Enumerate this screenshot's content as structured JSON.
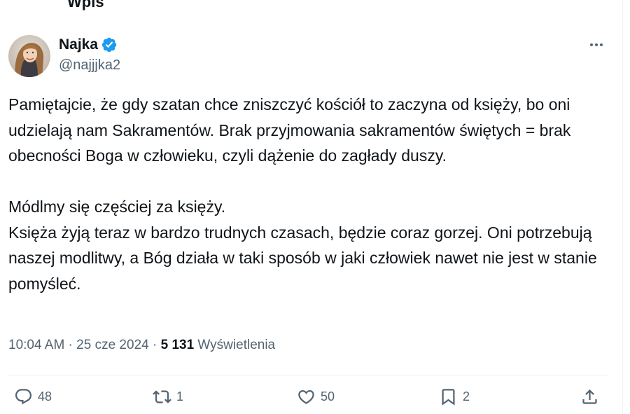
{
  "header": {
    "title_partial": "Wpis"
  },
  "author": {
    "display_name": "Najka",
    "handle": "@najjjka2",
    "verified_icon": "verified-badge-icon"
  },
  "tweet": {
    "paragraph1": "Pamiętajcie, że gdy szatan chce zniszczyć kościół to zaczyna od księży, bo oni udzielają nam Sakramentów. Brak przyjmowania sakramentów świętych = brak obecności Boga w człowieku, czyli dążenie do zagłady duszy.",
    "paragraph2_line1": "Módlmy się częściej za księży.",
    "paragraph2_rest": "Księża żyją teraz w bardzo trudnych czasach, będzie coraz gorzej. Oni potrzebują naszej modlitwy, a Bóg działa w taki sposób w jaki człowiek nawet nie jest w stanie pomyśleć."
  },
  "meta": {
    "time": "10:04 AM",
    "separator": " · ",
    "date": "25 cze 2024",
    "views_count": "5 131",
    "views_label": " Wyświetlenia"
  },
  "actions": {
    "replies": "48",
    "reposts": "1",
    "likes": "50",
    "bookmarks": "2"
  },
  "colors": {
    "text": "#0f1419",
    "secondary": "#536471",
    "verified": "#1d9bf0"
  }
}
